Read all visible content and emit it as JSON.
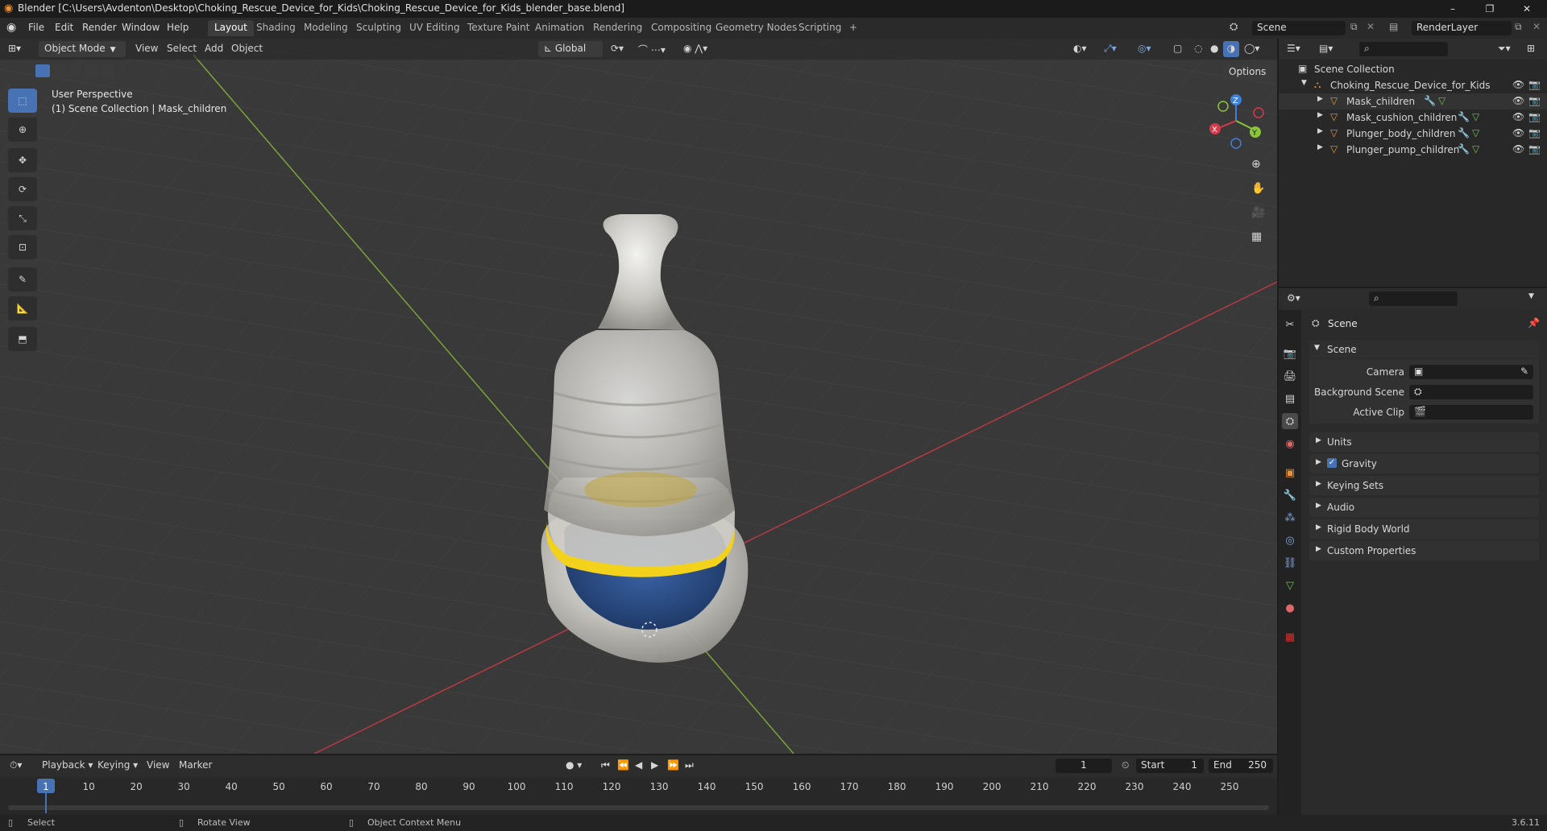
{
  "window": {
    "title": "Blender [C:\\Users\\Avdenton\\Desktop\\Choking_Rescue_Device_for_Kids\\Choking_Rescue_Device_for_Kids_blender_base.blend]",
    "minimize": "–",
    "maximize": "❐",
    "close": "✕"
  },
  "menu": {
    "items": [
      "File",
      "Edit",
      "Render",
      "Window",
      "Help"
    ],
    "workspaces": [
      "Layout",
      "Shading",
      "Modeling",
      "Sculpting",
      "UV Editing",
      "Texture Paint",
      "Animation",
      "Rendering",
      "Compositing",
      "Geometry Nodes",
      "Scripting"
    ],
    "add_tab": "+",
    "scene_name": "Scene",
    "view_layer": "RenderLayer"
  },
  "viewport": {
    "mode": "Object Mode",
    "menus": [
      "View",
      "Select",
      "Add",
      "Object"
    ],
    "transform_orientation": "Global",
    "options": "Options",
    "overlay_title": "User Perspective",
    "overlay_subtitle": "(1) Scene Collection | Mask_children",
    "gizmo_labels": {
      "x": "X",
      "y": "Y",
      "z": "Z"
    }
  },
  "outliner": {
    "root": "Scene Collection",
    "collection": "Choking_Rescue_Device_for_Kids",
    "objects": [
      "Mask_children",
      "Mask_cushion_children",
      "Plunger_body_children",
      "Plunger_pump_children"
    ]
  },
  "properties": {
    "context": "Scene",
    "section": "Scene",
    "fields": [
      {
        "label": "Camera"
      },
      {
        "label": "Background Scene"
      },
      {
        "label": "Active Clip"
      }
    ],
    "panels": [
      "Units",
      "Gravity",
      "Keying Sets",
      "Audio",
      "Rigid Body World",
      "Custom Properties"
    ],
    "gravity_checked": true
  },
  "timeline": {
    "menus": [
      "Playback",
      "Keying",
      "View",
      "Marker"
    ],
    "current_frame": "1",
    "start_label": "Start",
    "start": "1",
    "end_label": "End",
    "end": "250",
    "ruler": [
      "1",
      "10",
      "20",
      "30",
      "40",
      "50",
      "60",
      "70",
      "80",
      "90",
      "100",
      "110",
      "120",
      "130",
      "140",
      "150",
      "160",
      "170",
      "180",
      "190",
      "200",
      "210",
      "220",
      "230",
      "240",
      "250"
    ]
  },
  "status": {
    "select": "Select",
    "rotate": "Rotate View",
    "context_menu": "Object Context Menu",
    "version": "3.6.11"
  },
  "colors": {
    "accent": "#4772b3",
    "x_axis": "#d63a4a",
    "y_axis": "#8ac53a",
    "z_axis": "#3f7fd8",
    "object_orange": "#e8923a",
    "mesh_green": "#6cc24a",
    "ring_yellow": "#f2d21a"
  }
}
